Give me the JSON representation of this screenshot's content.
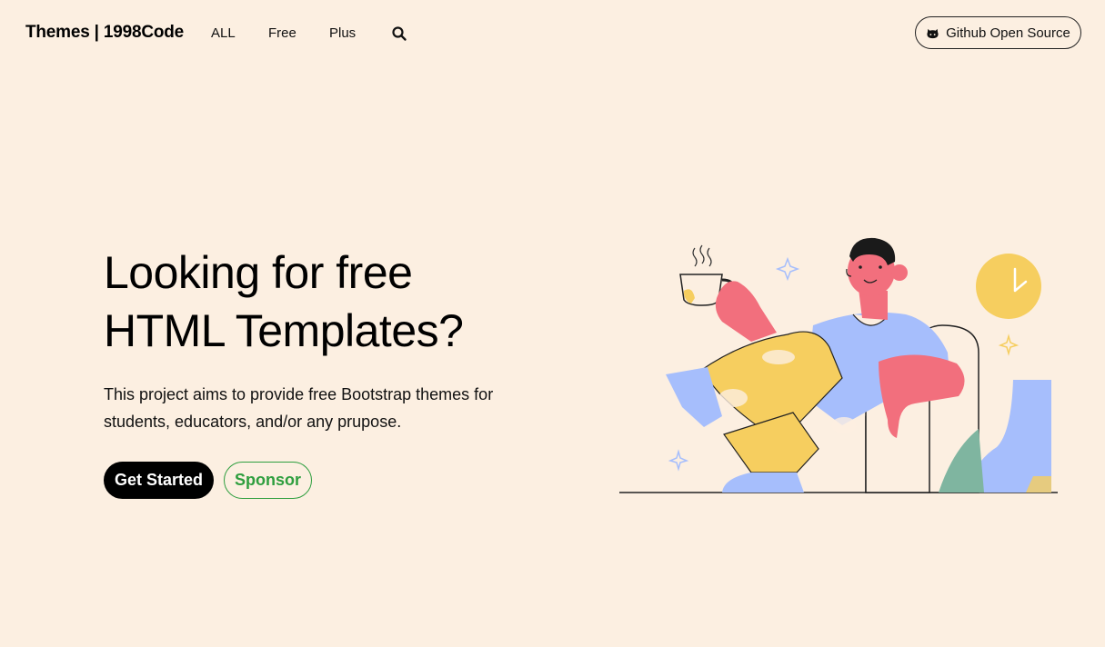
{
  "navbar": {
    "brand": "Themes | 1998Code",
    "links": [
      "ALL",
      "Free",
      "Plus"
    ],
    "search_icon": "search-icon",
    "github_button": "Github Open Source",
    "github_icon": "github-icon"
  },
  "hero": {
    "title_line1": "Looking for free",
    "title_line2": "HTML Templates?",
    "desc_line1": "This project aims to provide free Bootstrap themes for",
    "desc_line2": "students, educators, and/or any prupose.",
    "primary_button": "Get Started",
    "secondary_button": "Sponsor"
  },
  "colors": {
    "background": "#fcefe1",
    "primary_button": "#000000",
    "sponsor_green": "#2e9e3e",
    "accent_yellow": "#f6ce5f",
    "accent_pink": "#f26f7d",
    "accent_blue": "#a6befc",
    "accent_teal": "#7fb5a0"
  }
}
